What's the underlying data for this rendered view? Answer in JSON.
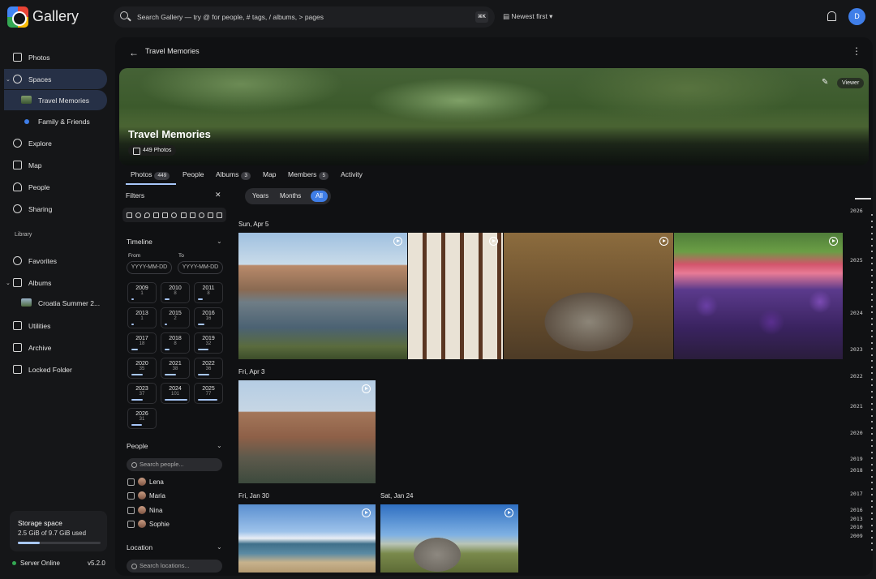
{
  "app": {
    "title": "Gallery",
    "user_initial": "D"
  },
  "search": {
    "placeholder": "Search Gallery — try @ for people, # tags, / albums, > pages",
    "shortcut": "⌘K"
  },
  "sort": {
    "label": "Newest first"
  },
  "sidebar": {
    "items": [
      {
        "label": "Photos"
      },
      {
        "label": "Spaces"
      },
      {
        "label": "Travel Memories"
      },
      {
        "label": "Family & Friends"
      },
      {
        "label": "Explore"
      },
      {
        "label": "Map"
      },
      {
        "label": "People"
      },
      {
        "label": "Sharing"
      }
    ],
    "library_header": "Library",
    "library": [
      {
        "label": "Favorites"
      },
      {
        "label": "Albums"
      },
      {
        "label": "Croatia Summer 2..."
      },
      {
        "label": "Utilities"
      },
      {
        "label": "Archive"
      },
      {
        "label": "Locked Folder"
      }
    ],
    "storage": {
      "title": "Storage space",
      "used": "2.5 GiB of 9.7 GiB used",
      "fraction": 0.26
    },
    "server_status": "Server Online",
    "version": "v5.2.0"
  },
  "page": {
    "title": "Travel Memories",
    "hero": {
      "title": "Travel Memories",
      "count": "449 Photos",
      "role": "Viewer"
    },
    "tabs": [
      {
        "label": "Photos",
        "count": "449"
      },
      {
        "label": "People",
        "count": ""
      },
      {
        "label": "Albums",
        "count": "3"
      },
      {
        "label": "Map",
        "count": ""
      },
      {
        "label": "Members",
        "count": "5"
      },
      {
        "label": "Activity",
        "count": ""
      }
    ]
  },
  "filters": {
    "title": "Filters",
    "timeline": {
      "title": "Timeline",
      "from_label": "From",
      "to_label": "To",
      "from_placeholder": "YYYY-MM-DD",
      "to_placeholder": "YYYY-MM-DD",
      "years": [
        {
          "year": "2009",
          "count": "1",
          "level": 0.1
        },
        {
          "year": "2010",
          "count": "8",
          "level": 0.2
        },
        {
          "year": "2011",
          "count": "8",
          "level": 0.2
        },
        {
          "year": "2013",
          "count": "1",
          "level": 0.1
        },
        {
          "year": "2015",
          "count": "2",
          "level": 0.1
        },
        {
          "year": "2016",
          "count": "16",
          "level": 0.3
        },
        {
          "year": "2017",
          "count": "18",
          "level": 0.3
        },
        {
          "year": "2018",
          "count": "8",
          "level": 0.2
        },
        {
          "year": "2019",
          "count": "32",
          "level": 0.45
        },
        {
          "year": "2020",
          "count": "35",
          "level": 0.5
        },
        {
          "year": "2021",
          "count": "38",
          "level": 0.5
        },
        {
          "year": "2022",
          "count": "36",
          "level": 0.5
        },
        {
          "year": "2023",
          "count": "37",
          "level": 0.5
        },
        {
          "year": "2024",
          "count": "101",
          "level": 1.0
        },
        {
          "year": "2025",
          "count": "77",
          "level": 0.85
        },
        {
          "year": "2026",
          "count": "31",
          "level": 0.45
        }
      ]
    },
    "people": {
      "title": "People",
      "search_placeholder": "Search people...",
      "list": [
        "Lena",
        "Maria",
        "Nina",
        "Sophie"
      ]
    },
    "location": {
      "title": "Location",
      "search_placeholder": "Search locations..."
    }
  },
  "view_toggle": {
    "options": [
      "Years",
      "Months",
      "All"
    ],
    "selected": "All"
  },
  "groups": [
    {
      "date": "Sun, Apr 5"
    },
    {
      "date": "Fri, Apr 3"
    },
    {
      "date": "Fri, Jan 30"
    },
    {
      "date": "Sat, Jan 24"
    }
  ],
  "year_rail": [
    "2026",
    "2025",
    "2024",
    "2023",
    "2022",
    "2021",
    "2020",
    "2019",
    "2018",
    "2017",
    "2016",
    "2013",
    "2010",
    "2009"
  ],
  "colors": {
    "accent": "#3f7ee8",
    "accent_light": "#a8c7fa",
    "online": "#34a853",
    "bg": "#151618",
    "panel": "#101113"
  }
}
